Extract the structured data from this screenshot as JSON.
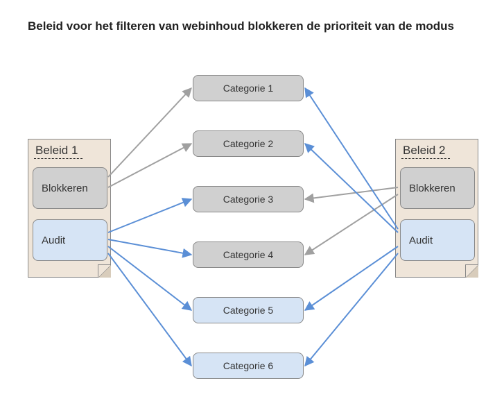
{
  "title": "Beleid voor het filteren van webinhoud blokkeren de prioriteit van de modus",
  "policy1": {
    "title": "Beleid 1",
    "block": "Blokkeren",
    "audit": "Audit"
  },
  "policy2": {
    "title": "Beleid 2",
    "block": "Blokkeren",
    "audit": "Audit"
  },
  "categories": {
    "c1": "Categorie  1",
    "c2": "Categorie  2",
    "c3": "Categorie  3",
    "c4": "Categorie  4",
    "c5": "Categorie  5",
    "c6": "Categorie  6"
  },
  "colors": {
    "grey_arrow": "#a0a0a0",
    "blue_arrow": "#5b8fd6",
    "box_grey": "#d0d0d0",
    "box_blue": "#d6e4f5",
    "paper": "#efe5d9"
  },
  "relations": {
    "policy1_block": [
      "c1",
      "c2"
    ],
    "policy1_audit": [
      "c3",
      "c4",
      "c5",
      "c6"
    ],
    "policy2_block": [
      "c3",
      "c4"
    ],
    "policy2_audit": [
      "c1",
      "c2",
      "c5",
      "c6"
    ]
  }
}
